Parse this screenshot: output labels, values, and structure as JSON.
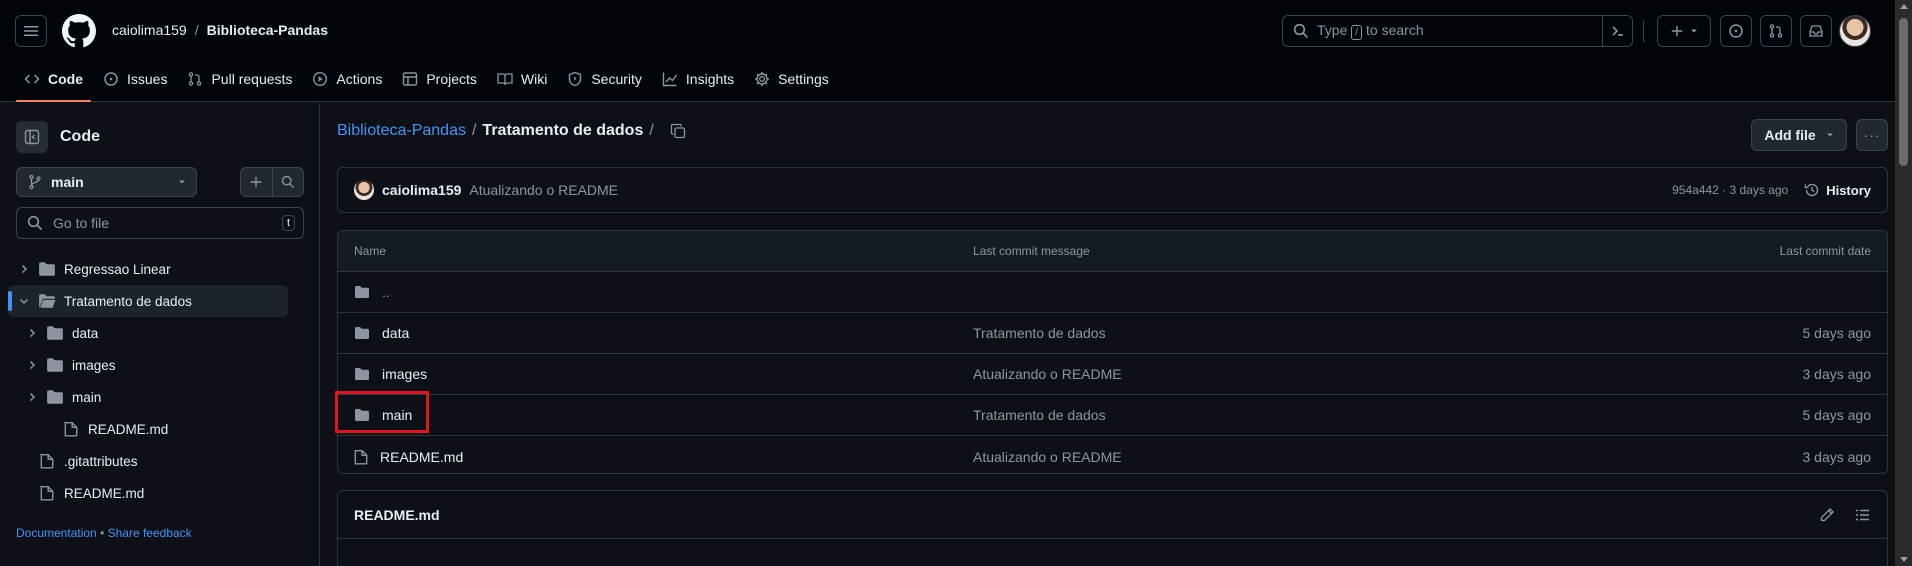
{
  "header": {
    "owner": "caiolima159",
    "separator": "/",
    "repo": "Biblioteca-Pandas",
    "search_prefix": "Type",
    "search_key": "/",
    "search_suffix": "to search"
  },
  "tabs": [
    {
      "label": "Code",
      "icon": "code-icon",
      "active": true
    },
    {
      "label": "Issues",
      "icon": "issue-icon"
    },
    {
      "label": "Pull requests",
      "icon": "pull-request-icon"
    },
    {
      "label": "Actions",
      "icon": "play-icon"
    },
    {
      "label": "Projects",
      "icon": "table-icon"
    },
    {
      "label": "Wiki",
      "icon": "book-icon"
    },
    {
      "label": "Security",
      "icon": "shield-icon"
    },
    {
      "label": "Insights",
      "icon": "graph-icon"
    },
    {
      "label": "Settings",
      "icon": "gear-icon"
    }
  ],
  "sidebar": {
    "title": "Code",
    "branch": "main",
    "goto_placeholder": "Go to file",
    "goto_shortcut": "t",
    "tree": [
      {
        "label": "Regressao Linear",
        "type": "folder",
        "level": 0,
        "expanded": false
      },
      {
        "label": "Tratamento de dados",
        "type": "folder",
        "level": 0,
        "expanded": true,
        "selected": true
      },
      {
        "label": "data",
        "type": "folder",
        "level": 1,
        "expanded": false
      },
      {
        "label": "images",
        "type": "folder",
        "level": 1,
        "expanded": false
      },
      {
        "label": "main",
        "type": "folder",
        "level": 1,
        "expanded": false
      },
      {
        "label": "README.md",
        "type": "file",
        "level": 1
      },
      {
        "label": ".gitattributes",
        "type": "file",
        "level": 0
      },
      {
        "label": "README.md",
        "type": "file",
        "level": 0
      }
    ],
    "footer_docs": "Documentation",
    "footer_dot": "•",
    "footer_feedback": "Share feedback"
  },
  "path": {
    "repo": "Biblioteca-Pandas",
    "sep": "/",
    "current": "Tratamento de dados",
    "trailing": "/"
  },
  "actions": {
    "add_file": "Add file",
    "more": "···"
  },
  "commit": {
    "author": "caiolima159",
    "message": "Atualizando o README",
    "meta": "954a442 · 3 days ago",
    "history": "History"
  },
  "table": {
    "headers": {
      "name": "Name",
      "message": "Last commit message",
      "date": "Last commit date"
    },
    "rows": [
      {
        "name": "..",
        "type": "folder",
        "message": "",
        "date": ""
      },
      {
        "name": "data",
        "type": "folder",
        "message": "Tratamento de dados",
        "date": "5 days ago"
      },
      {
        "name": "images",
        "type": "folder",
        "message": "Atualizando o README",
        "date": "3 days ago"
      },
      {
        "name": "main",
        "type": "folder",
        "message": "Tratamento de dados",
        "date": "5 days ago",
        "highlighted": true
      },
      {
        "name": "README.md",
        "type": "file",
        "message": "Atualizando o README",
        "date": "3 days ago"
      }
    ]
  },
  "readme": {
    "title": "README.md"
  },
  "colors": {
    "accent": "#4493f8",
    "highlight": "#e0141e",
    "underline": "#f78166"
  }
}
